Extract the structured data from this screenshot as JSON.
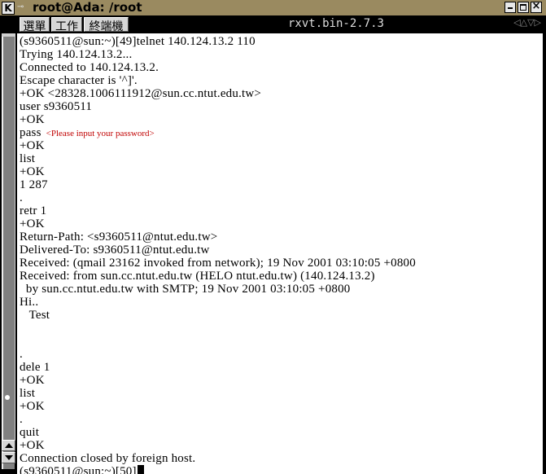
{
  "window": {
    "title": "root@Ada: /root",
    "k_button": "K",
    "pin_glyph": "⊸"
  },
  "menubar": {
    "items": [
      {
        "label": "選單"
      },
      {
        "label": "工作"
      },
      {
        "label": "終端機"
      }
    ],
    "terminal_title": "rxvt.bin-2.7.3",
    "arrows": "◁△▽▷"
  },
  "terminal": {
    "lines": [
      "(s9360511@sun:~)[49]telnet 140.124.13.2 110",
      "Trying 140.124.13.2...",
      "Connected to 140.124.13.2.",
      "Escape character is '^]'.",
      "+OK <28328.1006111912@sun.cc.ntut.edu.tw>",
      "user s9360511",
      "+OK",
      "pass",
      "+OK",
      "list",
      "+OK",
      "1 287",
      ".",
      "retr 1",
      "+OK",
      "Return-Path: <s9360511@ntut.edu.tw>",
      "Delivered-To: s9360511@ntut.edu.tw",
      "Received: (qmail 23162 invoked from network); 19 Nov 2001 03:10:05 +0800",
      "Received: from sun.cc.ntut.edu.tw (HELO ntut.edu.tw) (140.124.13.2)",
      "  by sun.cc.ntut.edu.tw with SMTP; 19 Nov 2001 03:10:05 +0800",
      "Hi..",
      "   Test",
      "",
      "",
      ".",
      "dele 1",
      "+OK",
      "list",
      "+OK",
      ".",
      "quit",
      "+OK",
      "Connection closed by foreign host.",
      "(s9360511@sun:~)[50]"
    ],
    "password_note": "<Please input your password>"
  },
  "colors": {
    "titlebar": "#9a8a60",
    "terminal_bg": "#ffffff",
    "note": "#c00000"
  }
}
